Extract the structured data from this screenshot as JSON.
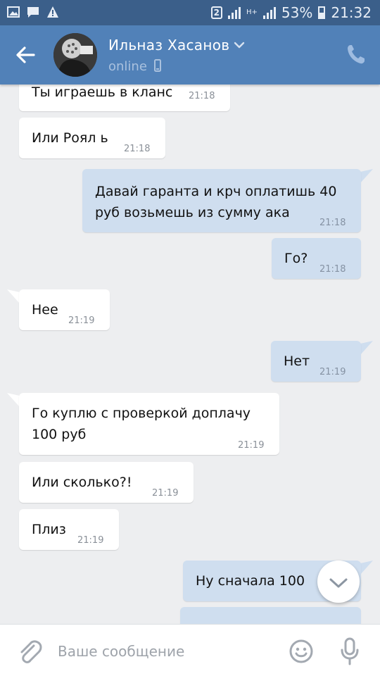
{
  "status_bar": {
    "sim": "2",
    "network": "H+",
    "battery": "53%",
    "time": "21:32"
  },
  "header": {
    "name": "Ильназ Хасанов",
    "status": "online",
    "accent": "#5181b8"
  },
  "messages": [
    {
      "dir": "in",
      "text": "Ты играешь в кланс",
      "time": "21:18"
    },
    {
      "dir": "in",
      "text": "Или Роял ь",
      "time": "21:18"
    },
    {
      "dir": "out",
      "lines": [
        "Давай гаранта и крч оплатишь 40",
        "руб возьмешь из сумму ака"
      ],
      "time": "21:18"
    },
    {
      "dir": "out",
      "text": "Го?",
      "time": "21:18"
    },
    {
      "dir": "in",
      "text": "Нее",
      "time": "21:19"
    },
    {
      "dir": "out",
      "text": "Нет",
      "time": "21:19"
    },
    {
      "dir": "in",
      "lines": [
        "Го куплю с проверкой доплачу",
        "100 руб"
      ],
      "time": "21:19"
    },
    {
      "dir": "in",
      "text": "Или сколько?!",
      "time": "21:19"
    },
    {
      "dir": "in",
      "text": "Плиз",
      "time": "21:19"
    },
    {
      "dir": "out",
      "text": "Ну сначала 100",
      "time": ""
    },
    {
      "dir": "out",
      "text": "",
      "time": ""
    }
  ],
  "composer": {
    "placeholder": "Ваше сообщение"
  },
  "icons": {
    "back": "back-arrow-icon",
    "call": "phone-icon",
    "attach": "paperclip-icon",
    "emoji": "smiley-icon",
    "mic": "microphone-icon",
    "scroll": "chevron-down-icon"
  }
}
